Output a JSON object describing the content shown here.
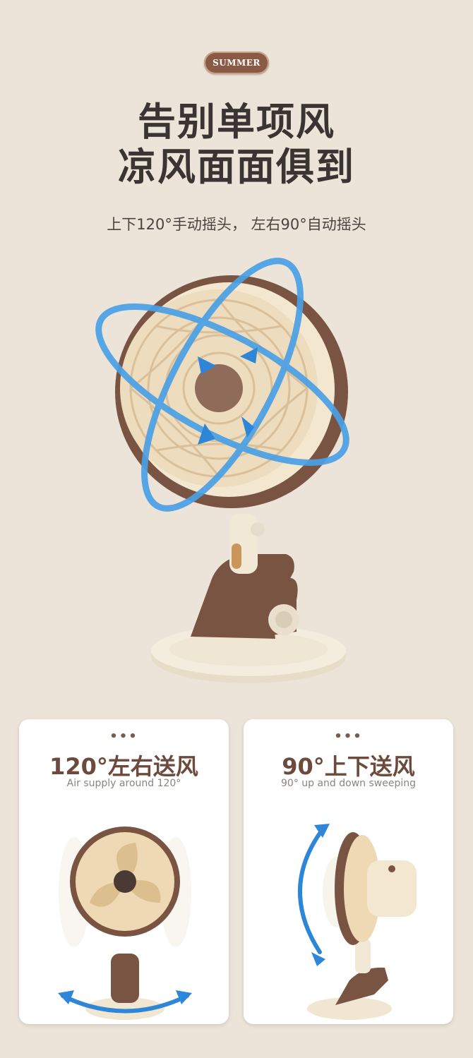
{
  "badge": "SUMMER",
  "headline": {
    "line1": "告别单项风",
    "line2": "凉风面面俱到"
  },
  "subtitle": "上下120°手动摇头， 左右90°自动摇头",
  "cards": [
    {
      "dots": "•••",
      "title": "120°左右送风",
      "subtitle": "Air supply around 120°"
    },
    {
      "dots": "•••",
      "title": "90°上下送风",
      "subtitle": "90° up and down sweeping"
    }
  ],
  "colors": {
    "background": "#ece4d8",
    "brown": "#7a5443",
    "cream": "#f3e7d0",
    "blade": "#efd8b4",
    "arrow": "#4aa0e6"
  }
}
